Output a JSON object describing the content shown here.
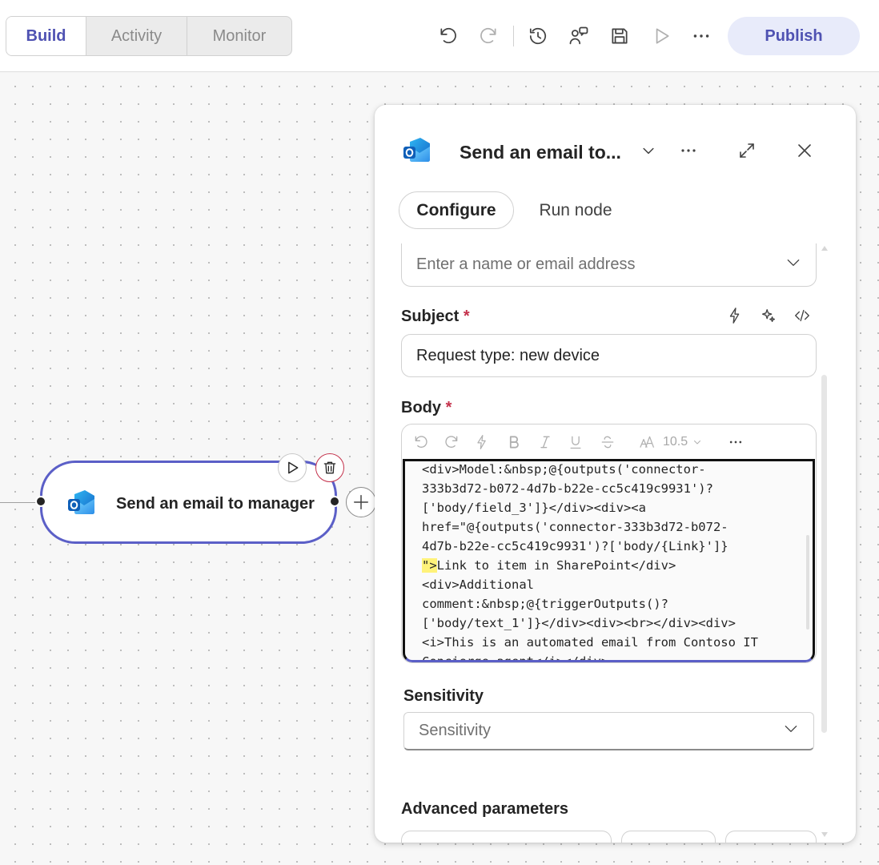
{
  "toolbar": {
    "tabs": [
      {
        "label": "Build",
        "active": true
      },
      {
        "label": "Activity",
        "active": false
      },
      {
        "label": "Monitor",
        "active": false
      }
    ],
    "icons": [
      "undo-icon",
      "redo-icon",
      "history-icon",
      "agent-chat-icon",
      "save-icon",
      "test-run-icon",
      "more-icon"
    ],
    "publish_label": "Publish"
  },
  "canvas": {
    "node": {
      "label": "Send an email to manager",
      "icon": "outlook-icon"
    }
  },
  "panel": {
    "title": "Send an email to...",
    "tabs": {
      "configure": "Configure",
      "run_node": "Run node"
    },
    "to": {
      "placeholder": "Enter a name or email address"
    },
    "subject": {
      "label": "Subject",
      "required_mark": "*",
      "value": "Request type: new device"
    },
    "body": {
      "label": "Body",
      "required_mark": "*",
      "font_size": "10.5",
      "lines": [
        "<div>Model:&nbsp;@{outputs('connector-",
        "333b3d72-b072-4d7b-b22e-cc5c419c9931')?",
        "['body/field_3']}</div><div><a",
        "href=\"@{outputs('connector-333b3d72-b072-",
        "4d7b-b22e-cc5c419c9931')?['body/{Link}']}",
        "\">",
        "<div>Additional",
        "comment:&nbsp;@{triggerOutputs()?",
        "['body/text_1']}</div><div><br></div><div>",
        "<i>This is an automated email from Contoso IT",
        "Concierge agent</i></div>"
      ],
      "line6_rest": "Link to item in SharePoint</div>"
    },
    "sensitivity": {
      "label": "Sensitivity",
      "placeholder": "Sensitivity"
    },
    "advanced": {
      "label": "Advanced parameters"
    }
  },
  "colors": {
    "accent": "#5b5fc7",
    "publish_bg": "#e8ebfa",
    "publish_text": "#4f52b2",
    "required": "#c4314b",
    "highlight": "#fff27a"
  }
}
